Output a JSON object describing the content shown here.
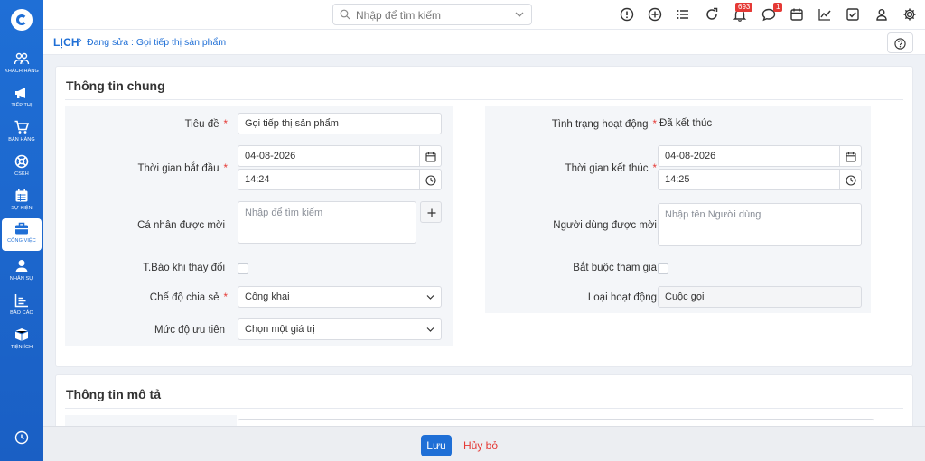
{
  "sidebar": {
    "items": [
      {
        "label": "KHÁCH HÀNG",
        "icon": "customers-icon"
      },
      {
        "label": "TIẾP THỊ",
        "icon": "megaphone-icon"
      },
      {
        "label": "BÁN HÀNG",
        "icon": "cart-icon"
      },
      {
        "label": "CSKH",
        "icon": "lifebuoy-icon"
      },
      {
        "label": "SỰ KIỆN",
        "icon": "calendar-icon"
      },
      {
        "label": "CÔNG VIỆC",
        "icon": "briefcase-icon"
      },
      {
        "label": "NHÂN SỰ",
        "icon": "person-icon"
      },
      {
        "label": "BÁO CÁO",
        "icon": "bar-chart-icon"
      },
      {
        "label": "TIỆN ÍCH",
        "icon": "box-icon"
      }
    ],
    "active_index": 5
  },
  "topbar": {
    "search_placeholder": "Nhập để tìm kiếm",
    "notif_count": "693",
    "msg_count": "1"
  },
  "breadcrumb": {
    "root": "LỊCH",
    "current": "Đang sửa : Gọi tiếp thị sản phẩm"
  },
  "general": {
    "title": "Thông tin chung",
    "left": {
      "subject_label": "Tiêu đề",
      "subject_value": "Gọi tiếp thị sản phẩm",
      "start_label": "Thời gian bắt đầu",
      "start_date": "04-08-2026",
      "start_time": "14:24",
      "invitees_label": "Cá nhân được mời",
      "invitees_placeholder": "Nhập để tìm kiếm",
      "notify_label": "T.Báo khi thay đổi",
      "share_label": "Chế độ chia sẻ",
      "share_value": "Công khai",
      "priority_label": "Mức độ ưu tiên",
      "priority_value": "Chọn một giá trị"
    },
    "right": {
      "status_label": "Tình trạng hoạt động",
      "status_value": "Đã kết thúc",
      "end_label": "Thời gian kết thúc",
      "end_date": "04-08-2026",
      "end_time": "14:25",
      "users_label": "Người dùng được mời",
      "users_placeholder": "Nhập tên Người dùng",
      "mandatory_label": "Bắt buộc tham gia",
      "type_label": "Loại hoạt động",
      "type_value": "Cuộc gọi"
    }
  },
  "description": {
    "title": "Thông tin mô tả"
  },
  "footer": {
    "save": "Lưu",
    "cancel": "Hủy bỏ"
  },
  "colors": {
    "primary": "#1f6fd6",
    "danger": "#e53935"
  }
}
